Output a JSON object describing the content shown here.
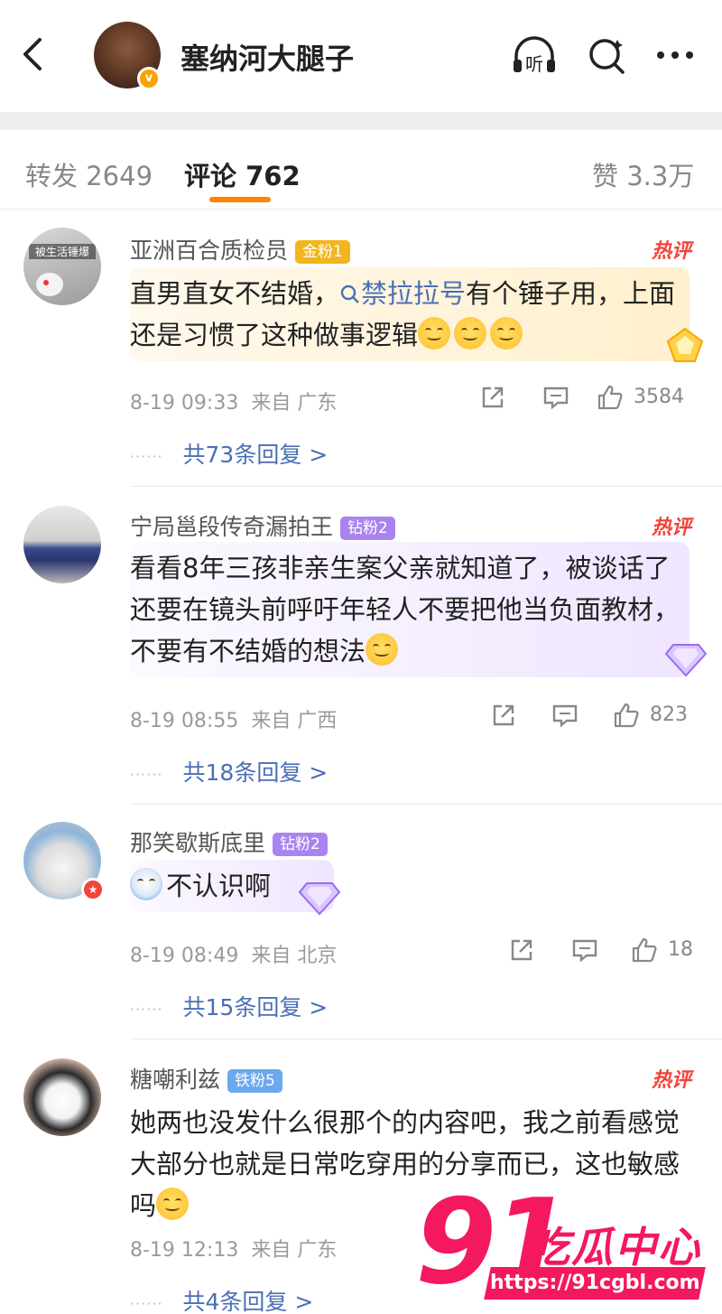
{
  "header": {
    "title": "塞纳河大腿子",
    "listen_label": "听"
  },
  "tabs": {
    "repost": "转发 2649",
    "comment": "评论 762",
    "like": "赞 3.3万"
  },
  "comments": [
    {
      "name": "亚洲百合质检员",
      "fan_badge": "金粉1",
      "hot": "热评",
      "avatar_text": "被生活锤爆",
      "text_before": "直男直女不结婚，",
      "topic": "禁拉拉号",
      "text_after": "有个锤子用，上面还是习惯了这种做事逻辑",
      "time": "8-19 09:33",
      "from": "来自 广东",
      "likes": "3584",
      "replies": "共73条回复 >",
      "dots": "······"
    },
    {
      "name": "宁局邕段传奇漏拍王",
      "fan_badge": "钻粉2",
      "hot": "热评",
      "text": "看看8年三孩非亲生案父亲就知道了，被谈话了还要在镜头前呼吁年轻人不要把他当负面教材，不要有不结婚的想法",
      "time": "8-19 08:55",
      "from": "来自 广西",
      "likes": "823",
      "replies": "共18条回复 >",
      "dots": "······"
    },
    {
      "name": "那笑歇斯底里",
      "fan_badge": "钻粉2",
      "text": "不认识啊",
      "time": "8-19 08:49",
      "from": "来自 北京",
      "likes": "18",
      "replies": "共15条回复 >",
      "dots": "······"
    },
    {
      "name": "糖嘲利兹",
      "fan_badge": "铁粉5",
      "hot": "热评",
      "text": "她两也没发什么很那个的内容吧，我之前看感觉大部分也就是日常吃穿用的分享而已，这也敏感吗",
      "time": "8-19 12:13",
      "from": "来自 广东",
      "replies": "共4条回复 >",
      "dots": "······"
    }
  ],
  "watermark": {
    "number": "91",
    "brand": "吃瓜中心",
    "url": "https://91cgbl.com"
  },
  "colors": {
    "accent_orange": "#ff8200",
    "link_blue": "#4a6fb5",
    "hot_red": "#f4433a",
    "watermark_pink": "#f4185e"
  }
}
